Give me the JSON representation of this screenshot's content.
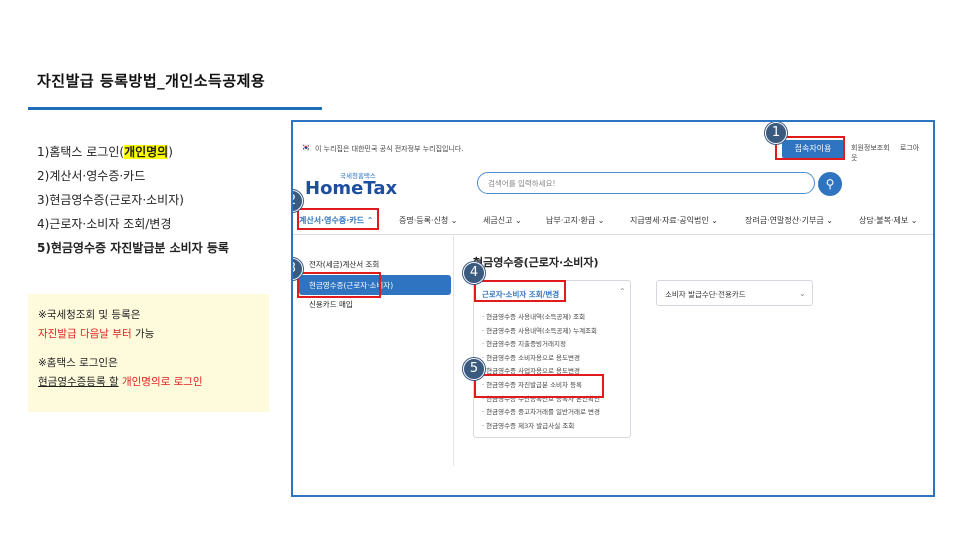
{
  "slide": {
    "title": "자진발급 등록방법_개인소득공제용",
    "steps": [
      {
        "pre": "1)홈택스 로그인(",
        "hl": "개인명의",
        "post": ")"
      },
      {
        "text": "2)계산서·영수증·카드"
      },
      {
        "text": "3)현금영수증(근로자·소비자)"
      },
      {
        "text": "4)근로자·소비자 조회/변경"
      },
      {
        "text": "5)현금영수증 자진발급분 소비자 등록"
      }
    ],
    "note": {
      "line1": "※국세청조회 및 등록은",
      "line2": "자진발급 다음날 부터 가능",
      "line2_red": "자진발급 다음날 부터",
      "line2_black": " 가능",
      "line3": "※홈택스 로그인은",
      "line4_u": "현금영수증등록 할",
      "line4_red": " 개인명의로 로그인"
    }
  },
  "screenshot": {
    "gov_notice": "이 누리집은 대한민국 공식 전자정부 누리집입니다.",
    "access_button": "접속자이용",
    "top_links": [
      "회원정보조회",
      "로그아웃"
    ],
    "logo_small": "국세청홈택스",
    "logo_big": "HomeTax",
    "search_placeholder": "검색어를 입력하세요!",
    "nav": [
      "계산서·영수증·카드 ⌃",
      "증명·등록·신청 ⌄",
      "세금신고 ⌄",
      "납부·고지·환급 ⌄",
      "지급명세·자료·공익법인 ⌄",
      "장려금·연말정산·기부금 ⌄",
      "상담·불복·제보 ⌄"
    ],
    "left_menu": {
      "item1": "전자(세금)계산서 조회",
      "active": "현금영수증(근로자·소비자)",
      "item3": "신용카드 매입"
    },
    "content_title": "현금영수증(근로자·소비자)",
    "panel_head": "근로자·소비자 조회/변경",
    "panel_items": [
      "현금영수증 사용내역(소득공제) 조회",
      "현금영수증 사용내역(소득공제) 누계조회",
      "현금영수증 지출증빙거래지정",
      "현금영수증 소비자용으로 용도변경",
      "현금영수증 사업자용으로 용도변경",
      "현금영수증 자진발급분 소비자 등록",
      "현금영수증 수단등록번호 등록자 본인확인",
      "현금영수증 중고차거래를 일반거래로 변경",
      "현금영수증 제3자 발급사실 조회"
    ],
    "panel2_label": "소비자 발급수단·전용카드",
    "badges": [
      "1",
      "2",
      "3",
      "4",
      "5"
    ]
  }
}
